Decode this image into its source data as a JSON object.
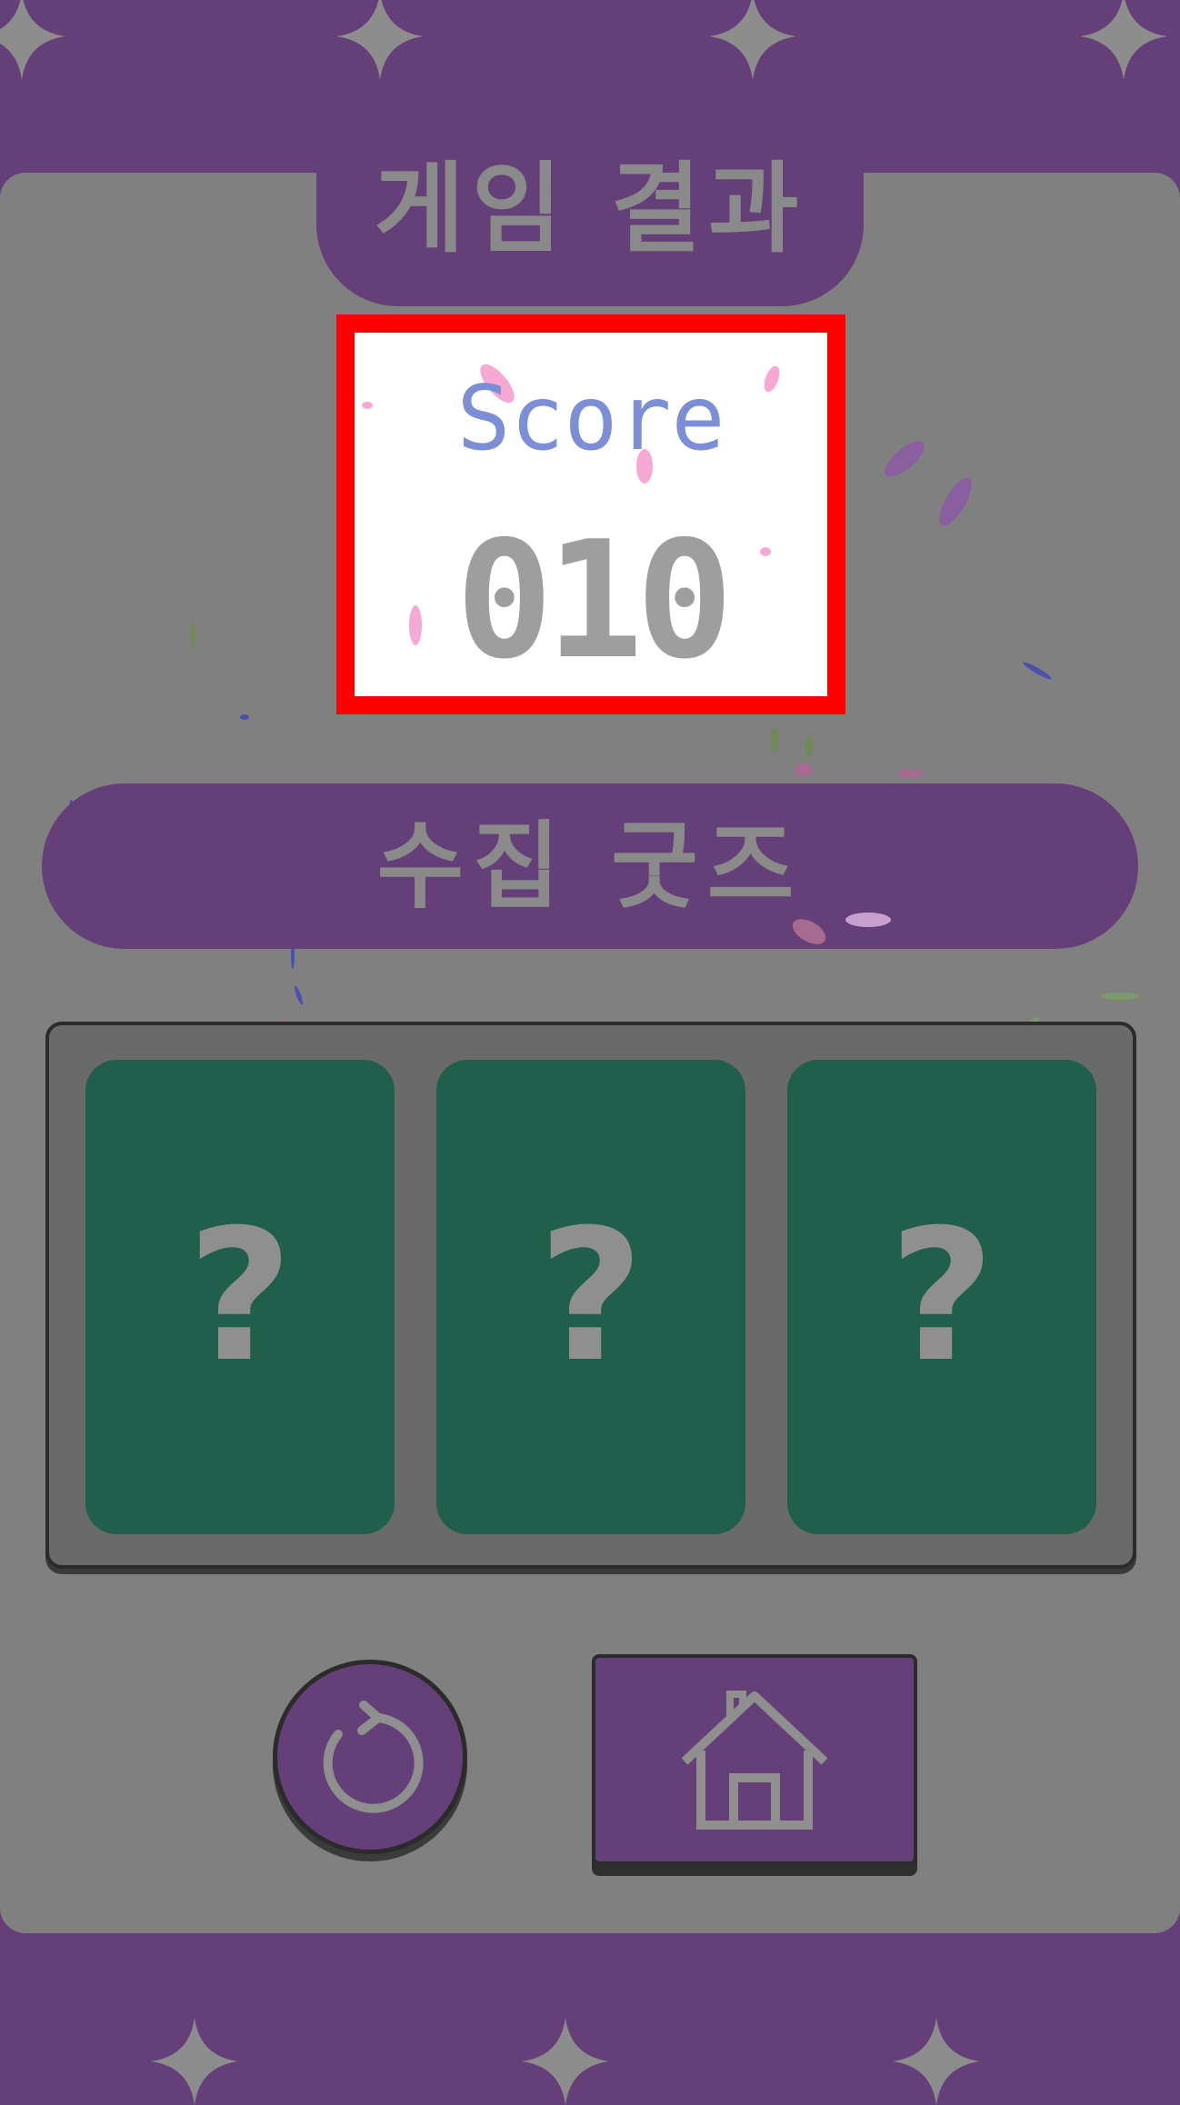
{
  "colors": {
    "background_purple": "#653f78",
    "panel_gray": "#808080",
    "card_green": "#1f5f4b",
    "score_label_blue": "#7b8ed6",
    "highlight_red": "#ff0000",
    "muted_text": "#8a8a8a"
  },
  "header": {
    "title": "게임 결과"
  },
  "score": {
    "label": "Score",
    "value": "010"
  },
  "goods": {
    "title": "수집 굿즈",
    "cards": [
      {
        "label": "?"
      },
      {
        "label": "?"
      },
      {
        "label": "?"
      }
    ]
  },
  "buttons": {
    "retry": {
      "icon": "restart-icon"
    },
    "home": {
      "icon": "home-icon"
    }
  },
  "decorations": {
    "star_icon": "four-point-sparkle",
    "confetti": "falling-petals"
  }
}
